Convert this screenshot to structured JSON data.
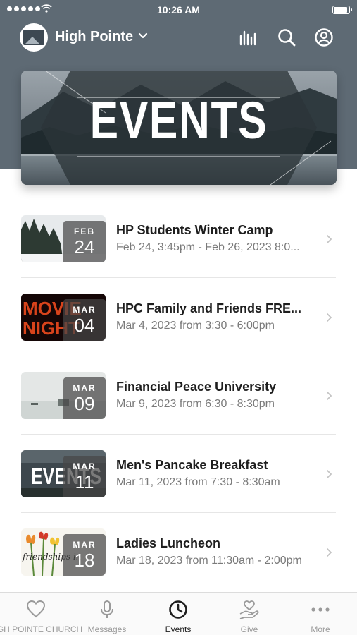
{
  "status_bar": {
    "time": "10:26 AM"
  },
  "header": {
    "campus_name": "High Pointe"
  },
  "hero": {
    "title": "EVENTS"
  },
  "events": [
    {
      "title": "HP Students Winter Camp",
      "subtitle": "Feb 24, 3:45pm - Feb 26, 2023 8:0...",
      "month": "FEB",
      "day": "24"
    },
    {
      "title": "HPC Family and Friends FRE...",
      "subtitle": "Mar 4, 2023 from 3:30 - 6:00pm",
      "month": "MAR",
      "day": "04"
    },
    {
      "title": "Financial Peace University",
      "subtitle": "Mar 9, 2023 from 6:30 - 8:30pm",
      "month": "MAR",
      "day": "09"
    },
    {
      "title": "Men's Pancake Breakfast",
      "subtitle": "Mar 11, 2023 from 7:30 - 8:30am",
      "month": "MAR",
      "day": "11"
    },
    {
      "title": "Ladies Luncheon",
      "subtitle": "Mar 18, 2023 from 11:30am - 2:00pm",
      "month": "MAR",
      "day": "18"
    }
  ],
  "thumbnails": {
    "movie_night_text": [
      "MOVIE",
      "NIGHT"
    ],
    "mens_text": "EVENTS",
    "ladies_text": "friendships in"
  },
  "tabs": [
    {
      "label": "HIGH POINTE CHURCH",
      "icon": "heart-icon",
      "active": false
    },
    {
      "label": "Messages",
      "icon": "microphone-icon",
      "active": false
    },
    {
      "label": "Events",
      "icon": "clock-icon",
      "active": true
    },
    {
      "label": "Give",
      "icon": "giving-hand-icon",
      "active": false
    },
    {
      "label": "More",
      "icon": "more-dots-icon",
      "active": false
    }
  ],
  "colors": {
    "header_bg": "#5e6a74",
    "active_tab": "#1e1e1e",
    "inactive_tab": "#9a9a9a"
  }
}
